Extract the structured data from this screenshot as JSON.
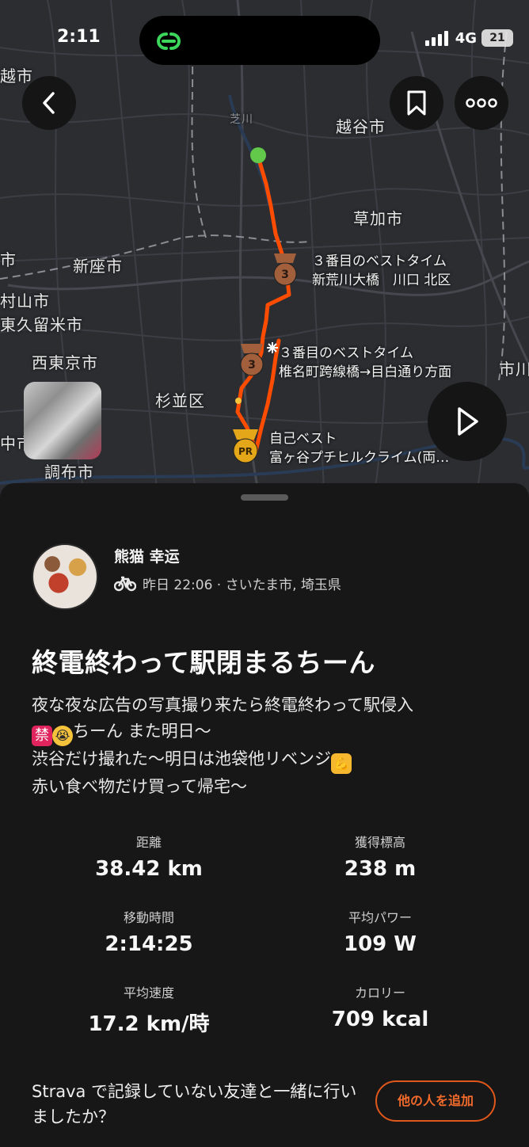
{
  "status_bar": {
    "time": "2:11",
    "network": "4G",
    "battery": "21"
  },
  "map": {
    "places": [
      {
        "name": "越市"
      },
      {
        "name": "越谷市"
      },
      {
        "name": "草加市"
      },
      {
        "name": "市"
      },
      {
        "name": "新座市"
      },
      {
        "name": "村山市"
      },
      {
        "name": "東久留米市"
      },
      {
        "name": "西東京市"
      },
      {
        "name": "杉並区"
      },
      {
        "name": "中市"
      },
      {
        "name": "調布市"
      },
      {
        "name": "市川"
      },
      {
        "name": "芝川"
      }
    ],
    "segments": [
      {
        "rank": "3",
        "line1": "３番目のベストタイム",
        "line2": "新荒川大橋　川口 北区"
      },
      {
        "rank": "3",
        "line1": "３番目のベストタイム",
        "line2": "椎名町跨線橋→目白通り方面"
      },
      {
        "rank": "PR",
        "line1": "自己ベスト",
        "line2": "富ヶ谷プチヒルクライム(両…"
      }
    ],
    "colors": {
      "route": "#fc4c02",
      "start": "#62c94a",
      "bronze": "#a25f3c",
      "gold": "#e3a719"
    }
  },
  "activity": {
    "user_name": "熊猫 幸运",
    "sport_icon": "bike-icon",
    "meta": "昨日 22:06 · さいたま市, 埼玉県",
    "title": "終電終わって駅閉まるちーん",
    "description_lines": [
      "夜な夜な広告の写真撮り来たら終電終わって駅侵入",
      "ちーん また明日〜",
      "渋谷だけ撮れた〜明日は池袋他リベンジ",
      "赤い食べ物だけ買って帰宅〜"
    ],
    "emoji": {
      "ban": "禁",
      "cry": "😭",
      "arm": "💪"
    }
  },
  "stats": [
    {
      "label": "距離",
      "value": "38.42 km"
    },
    {
      "label": "獲得標高",
      "value": "238 m"
    },
    {
      "label": "移動時間",
      "value": "2:14:25"
    },
    {
      "label": "平均パワー",
      "value": "109 W"
    },
    {
      "label": "平均速度",
      "value": "17.2 km/時"
    },
    {
      "label": "カロリー",
      "value": "709 kcal"
    }
  ],
  "invite": {
    "text": "Strava で記録していない友達と一緒に行いましたか？",
    "button": "他の人を追加"
  }
}
